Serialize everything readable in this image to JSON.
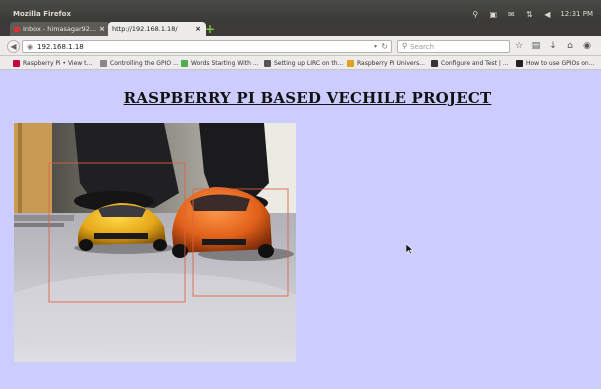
{
  "window": {
    "title": "Mozilla Firefox",
    "clock": "12:31 PM"
  },
  "tabs": [
    {
      "label": "Inbox - himasagar92...",
      "active": false
    },
    {
      "label": "http://192.168.1.18/",
      "active": true
    }
  ],
  "navbar": {
    "url": "192.168.1.18",
    "search_placeholder": "Search"
  },
  "bookmarks": [
    {
      "label": "Raspberry Pi • View t...",
      "icon_color": "#c7053d"
    },
    {
      "label": "Controlling the GPIO ...",
      "icon_color": "#888888"
    },
    {
      "label": "Words Starting With ...",
      "icon_color": "#4caf50"
    },
    {
      "label": "Setting up LIRC on th...",
      "icon_color": "#555555"
    },
    {
      "label": "Raspberry Pi Univers...",
      "icon_color": "#e0a020"
    },
    {
      "label": "Configure and Test | ...",
      "icon_color": "#333333"
    },
    {
      "label": "How to use GPIOs on...",
      "icon_color": "#222222"
    }
  ],
  "page": {
    "heading": "RASPBERRY PI BASED VECHILE PROJECT",
    "background": "#ccccff"
  },
  "camera_feed": {
    "cars": [
      {
        "color": "yellow"
      },
      {
        "color": "orange"
      }
    ],
    "detection_box_color": "#e06040"
  }
}
